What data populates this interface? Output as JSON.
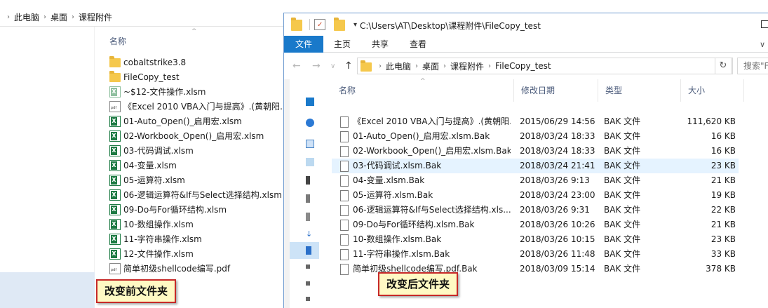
{
  "left": {
    "breadcrumb": [
      "此电脑",
      "桌面",
      "课程附件"
    ],
    "header_name": "名称",
    "files": [
      {
        "name": "cobaltstrike3.8",
        "icon": "folder-icon"
      },
      {
        "name": "FileCopy_test",
        "icon": "folder-icon"
      },
      {
        "name": "~$12-文件操作.xlsm",
        "icon": "excel-temp-file-icon"
      },
      {
        "name": "《Excel 2010 VBA入门与提高》.(黄朝阳...",
        "icon": "pdf-file-icon"
      },
      {
        "name": "01-Auto_Open()_启用宏.xlsm",
        "icon": "excel-file-icon"
      },
      {
        "name": "02-Workbook_Open()_启用宏.xlsm",
        "icon": "excel-file-icon"
      },
      {
        "name": "03-代码调试.xlsm",
        "icon": "excel-file-icon"
      },
      {
        "name": "04-变量.xlsm",
        "icon": "excel-file-icon"
      },
      {
        "name": "05-运算符.xlsm",
        "icon": "excel-file-icon"
      },
      {
        "name": "06-逻辑运算符&If与Select选择结构.xlsm",
        "icon": "excel-file-icon"
      },
      {
        "name": "09-Do与For循环结构.xlsm",
        "icon": "excel-file-icon"
      },
      {
        "name": "10-数组操作.xlsm",
        "icon": "excel-file-icon"
      },
      {
        "name": "11-字符串操作.xlsm",
        "icon": "excel-file-icon"
      },
      {
        "name": "12-文件操作.xlsm",
        "icon": "excel-file-icon"
      },
      {
        "name": "简单初级shellcode编写.pdf",
        "icon": "pdf-file-icon"
      }
    ],
    "caption": "改变前文件夹"
  },
  "right": {
    "title": "C:\\Users\\AT\\Desktop\\课程附件\\FileCopy_test",
    "ribbon_tabs": [
      "文件",
      "主页",
      "共享",
      "查看"
    ],
    "breadcrumb": [
      "此电脑",
      "桌面",
      "课程附件",
      "FileCopy_test"
    ],
    "search_placeholder": "搜索\"F",
    "columns": {
      "name": "名称",
      "date": "修改日期",
      "type": "类型",
      "size": "大小"
    },
    "rows": [
      {
        "name": "《Excel 2010 VBA入门与提高》.(黄朝阳...",
        "date": "2015/06/29 14:56",
        "type": "BAK 文件",
        "size": "111,620 KB"
      },
      {
        "name": "01-Auto_Open()_启用宏.xlsm.Bak",
        "date": "2018/03/24 18:33",
        "type": "BAK 文件",
        "size": "16 KB"
      },
      {
        "name": "02-Workbook_Open()_启用宏.xlsm.Bak",
        "date": "2018/03/24 18:33",
        "type": "BAK 文件",
        "size": "16 KB"
      },
      {
        "name": "03-代码调试.xlsm.Bak",
        "date": "2018/03/24 21:41",
        "type": "BAK 文件",
        "size": "23 KB"
      },
      {
        "name": "04-变量.xlsm.Bak",
        "date": "2018/03/26 9:13",
        "type": "BAK 文件",
        "size": "21 KB"
      },
      {
        "name": "05-运算符.xlsm.Bak",
        "date": "2018/03/24 23:00",
        "type": "BAK 文件",
        "size": "19 KB"
      },
      {
        "name": "06-逻辑运算符&If与Select选择结构.xls...",
        "date": "2018/03/26 9:31",
        "type": "BAK 文件",
        "size": "22 KB"
      },
      {
        "name": "09-Do与For循环结构.xlsm.Bak",
        "date": "2018/03/26 10:26",
        "type": "BAK 文件",
        "size": "21 KB"
      },
      {
        "name": "10-数组操作.xlsm.Bak",
        "date": "2018/03/26 10:15",
        "type": "BAK 文件",
        "size": "23 KB"
      },
      {
        "name": "11-字符串操作.xlsm.Bak",
        "date": "2018/03/26 11:48",
        "type": "BAK 文件",
        "size": "33 KB"
      },
      {
        "name": "简单初级shellcode编写.pdf.Bak",
        "date": "2018/03/09 15:14",
        "type": "BAK 文件",
        "size": "378 KB"
      }
    ],
    "selected_row": 3,
    "caption": "改变后文件夹"
  }
}
